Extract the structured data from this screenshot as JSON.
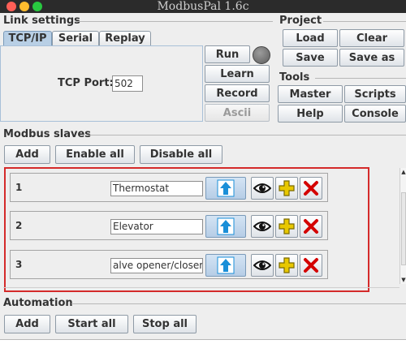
{
  "window": {
    "title": "ModbusPal 1.6c",
    "buttons": [
      "close",
      "minimize",
      "maximize"
    ]
  },
  "link_settings": {
    "title": "Link settings",
    "tabs": [
      "TCP/IP",
      "Serial",
      "Replay"
    ],
    "active_tab": "TCP/IP",
    "tcp_port_label": "TCP Port:",
    "tcp_port_value": "502",
    "run_label": "Run",
    "learn_label": "Learn",
    "record_label": "Record",
    "ascii_label": "Ascii"
  },
  "project": {
    "title": "Project",
    "load_label": "Load",
    "clear_label": "Clear",
    "save_label": "Save",
    "save_as_label": "Save as"
  },
  "tools": {
    "title": "Tools",
    "master_label": "Master",
    "scripts_label": "Scripts",
    "help_label": "Help",
    "console_label": "Console"
  },
  "modbus_slaves": {
    "title": "Modbus slaves",
    "add_label": "Add",
    "enable_all_label": "Enable all",
    "disable_all_label": "Disable all",
    "slaves": [
      {
        "id": "1",
        "name": "Thermostat"
      },
      {
        "id": "2",
        "name": "Elevator"
      },
      {
        "id": "3",
        "name": "alve opener/closer"
      }
    ],
    "icons": [
      "arrow-up-icon",
      "eye-icon",
      "puzzle-icon",
      "delete-x-icon"
    ]
  },
  "automation": {
    "title": "Automation",
    "add_label": "Add",
    "start_all_label": "Start all",
    "stop_all_label": "Stop all"
  },
  "colors": {
    "highlight_border": "#d42a2a",
    "tab_active": "#b8cfe5",
    "delete_icon": "#d40000",
    "puzzle_icon": "#e8c800",
    "up_arrow": "#1a8fd8"
  }
}
